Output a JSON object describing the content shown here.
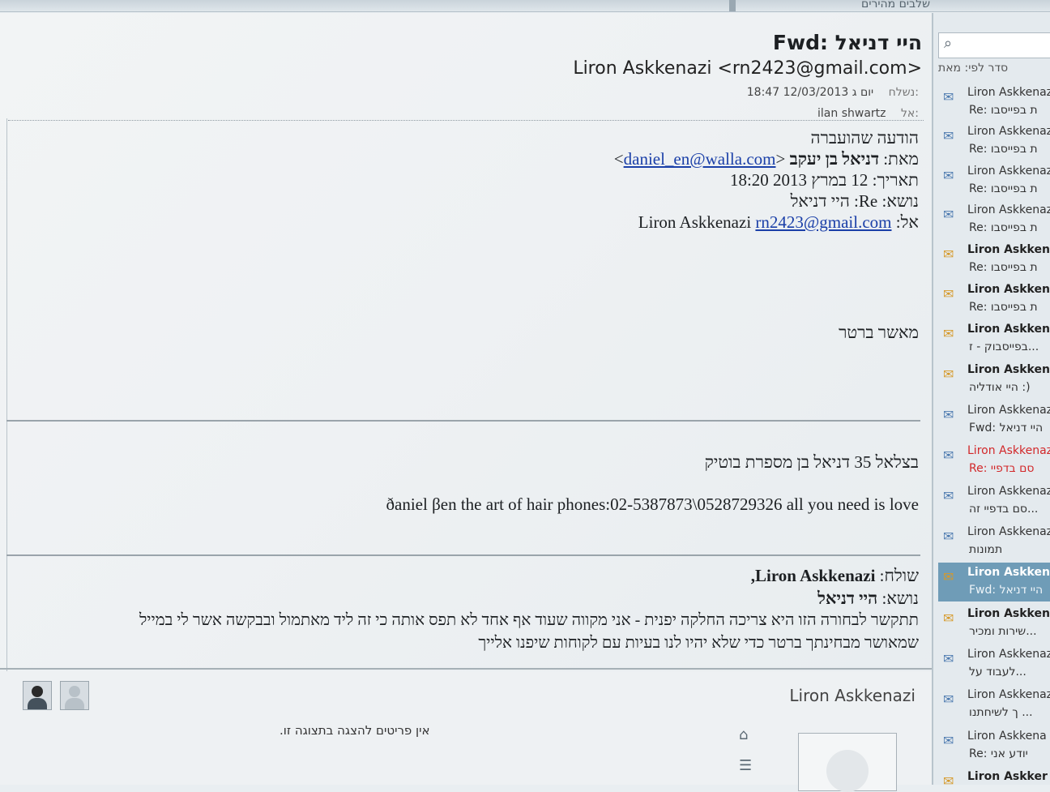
{
  "top_bar": {
    "folder_crumb": "שלבים מהירים"
  },
  "message": {
    "subject": "היי דניאל :Fwd",
    "sender_display": "Liron Askkenazi <rn2423@gmail.com>",
    "sent_label": ":נשלח",
    "sent_value": "יום ג 12/03/2013 18:47",
    "to_label": ":אל",
    "to_value": "ilan shwartz"
  },
  "forwarded": {
    "intro": "הודעה שהועברה",
    "from_label": "מאת:",
    "from_name": "דניאל בן יעקב",
    "from_email": "daniel_en@walla.com",
    "date_line": "תאריך: 12 במרץ 2013 18:20",
    "subject_line": "נושא: Re: היי דניאל",
    "to_label": "אל:",
    "to_name": "Liron Askkenazi",
    "to_email": "rn2423@gmail.com",
    "approval": "מאשר ברטר",
    "signature_1": "בצלאל 35 דניאל בן מספרת בוטיק",
    "signature_2": "ðaniel βen  the art of hair phones:02-5387873\\0528729326  all you need is love",
    "quoted_sender_label": "שולח:",
    "quoted_sender": "Liron Askkenazi,",
    "quoted_subject_label": "נושא:",
    "quoted_subject": "היי דניאל",
    "quoted_body_1": "תתקשר לבחורה הזו היא צריכה החלקה יפנית - אני מקווה שעוד אף אחד לא תפס אותה כי זה ליד מאתמול ובבקשה אשר לי במייל",
    "quoted_body_2": "שמאושר מבחינתך ברטר כדי שלא יהיו לנו בעיות עם לקוחות שיפנו אלייך"
  },
  "people_pane": {
    "contact_name": "Liron Askkenazi",
    "empty_text": "אין פריטים להצגה בתצוגה זו."
  },
  "list": {
    "sort_label": "סדר לפי: מאת",
    "items": [
      {
        "from": "Liron Askkenazi",
        "subject": "Re: ת בפייסבו"
      },
      {
        "from": "Liron Askkenazi",
        "subject": "Re: ת בפייסבו"
      },
      {
        "from": "Liron Askkenazi",
        "subject": "Re: ת בפייסבו"
      },
      {
        "from": "Liron Askkenazi",
        "subject": "Re: ת בפייסבו"
      },
      {
        "from": "Liron Askkena",
        "subject": "Re: ת בפייסבו"
      },
      {
        "from": "Liron Askkena",
        "subject": "Re: ת בפייסבו"
      },
      {
        "from": "Liron Askkena",
        "subject": "בפייסבוק - ז..."
      },
      {
        "from": "Liron Askkena",
        "subject": "היי אודליה :)"
      },
      {
        "from": "Liron Askkenaz",
        "subject": "Fwd: היי דניאל"
      },
      {
        "from": "Liron Askkenaz",
        "subject": "Re: סם בדפיי"
      },
      {
        "from": "Liron Askkenaz",
        "subject": "סם בדפיי זה..."
      },
      {
        "from": "Liron Askkenaz",
        "subject": "תמונות"
      },
      {
        "from": "Liron Askken",
        "subject": "Fwd: היי דניאל"
      },
      {
        "from": "Liron Askken",
        "subject": "שירות ומכיר..."
      },
      {
        "from": "Liron Askkenaz",
        "subject": "לעבוד על..."
      },
      {
        "from": "Liron Askkenaz",
        "subject": "ך לשיחתנו ..."
      },
      {
        "from": "Liron Askkena",
        "subject": "Re: יודע אני"
      },
      {
        "from": "Liron Askker",
        "subject": ""
      }
    ]
  }
}
